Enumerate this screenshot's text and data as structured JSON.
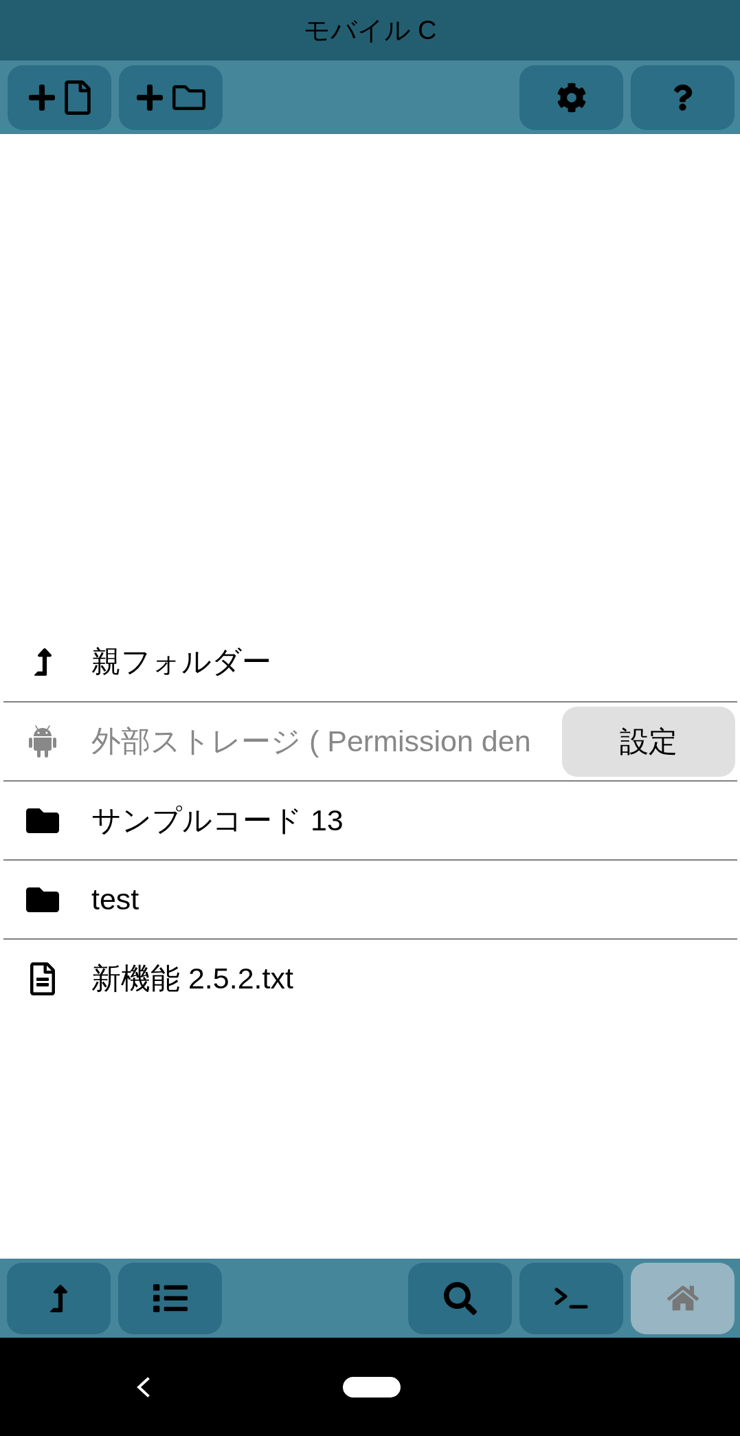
{
  "title": "モバイル C",
  "toolbar": {
    "left": [
      {
        "kind": "new_file"
      },
      {
        "kind": "new_folder"
      }
    ],
    "right": [
      {
        "kind": "settings"
      },
      {
        "kind": "help"
      }
    ]
  },
  "files": [
    {
      "kind": "parent",
      "name": "親フォルダー",
      "disabled": false
    },
    {
      "kind": "storage",
      "name": "外部ストレージ ( Permission den",
      "disabled": true,
      "button": "設定"
    },
    {
      "kind": "folder",
      "name": "サンプルコード 13",
      "disabled": false
    },
    {
      "kind": "folder",
      "name": "test",
      "disabled": false
    },
    {
      "kind": "file",
      "name": "新機能 2.5.2.txt",
      "disabled": false
    }
  ],
  "bottom_bar": {
    "left": [
      {
        "kind": "parent",
        "disabled": false
      },
      {
        "kind": "list",
        "disabled": false
      }
    ],
    "right": [
      {
        "kind": "search",
        "disabled": false
      },
      {
        "kind": "terminal",
        "disabled": false
      },
      {
        "kind": "home",
        "disabled": true
      }
    ]
  }
}
